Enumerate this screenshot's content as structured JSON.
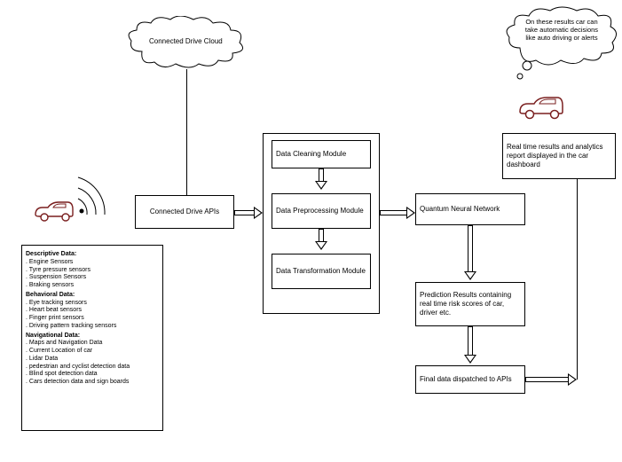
{
  "cloud": {
    "label": "Connected Drive Cloud"
  },
  "apis": {
    "label": "Connected Drive APIs"
  },
  "pipeline": {
    "cleaning": "Data Cleaning Module",
    "preprocessing": "Data Preprocessing Module",
    "transformation": "Data Transformation Module"
  },
  "qnn": {
    "label": "Quantum Neural Network"
  },
  "prediction": {
    "label": "Prediction Results containing real time risk scores of car, driver etc."
  },
  "dispatch": {
    "label": "Final data dispatched to APIs"
  },
  "dashboard": {
    "label": "Real time results and analytics report displayed in the car dashboard"
  },
  "thought": {
    "label": "On these results car can take automatic decisions like auto driving or alerts"
  },
  "data_panel": {
    "cat1_title": "Descriptive Data:",
    "cat1": {
      "i0": "Engine Sensors",
      "i1": "Tyre pressure sensors",
      "i2": "Suspension Sensors",
      "i3": "Braking sensors"
    },
    "cat2_title": "Behavioral Data:",
    "cat2": {
      "i0": "Eye tracking sensors",
      "i1": "Heart beat sensors",
      "i2": "Finger print sensors",
      "i3": "Driving pattern tracking sensors"
    },
    "cat3_title": "Navigational Data:",
    "cat3": {
      "i0": "Maps and Navigation Data",
      "i1": "Current Location of car",
      "i2": "Lidar Data",
      "i3": "pedestrian and cyclist detection data",
      "i4": "Blind spot detection data",
      "i5": "Cars detection data and sign boards"
    }
  }
}
